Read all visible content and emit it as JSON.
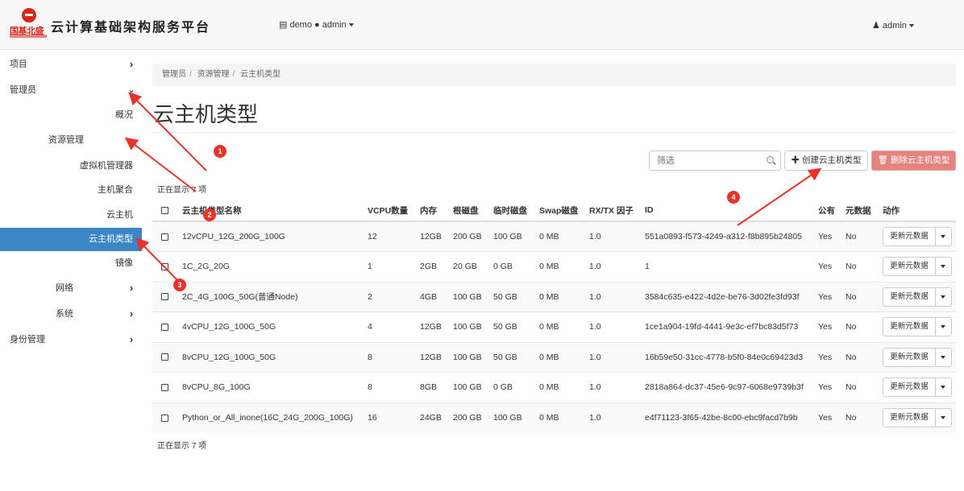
{
  "header": {
    "logo_text": "国基北盛",
    "title": "云计算基础架构服务平台",
    "project_switch": "▤ demo ● admin",
    "user_menu": "♟ admin"
  },
  "sidebar": {
    "items": [
      {
        "label": "项目"
      },
      {
        "label": "管理员"
      },
      {
        "label": "概况"
      },
      {
        "label": "资源管理"
      },
      {
        "label": "虚拟机管理器"
      },
      {
        "label": "主机聚合"
      },
      {
        "label": "云主机"
      },
      {
        "label": "云主机类型"
      },
      {
        "label": "镜像"
      },
      {
        "label": "网络"
      },
      {
        "label": "系统"
      },
      {
        "label": "身份管理"
      }
    ]
  },
  "breadcrumb": [
    "管理员",
    "资源管理",
    "云主机类型"
  ],
  "page_title": "云主机类型",
  "toolbar": {
    "filter_placeholder": "筛选",
    "create_label": "✚ 创建云主机类型",
    "delete_label": "🗑 删除云主机类型"
  },
  "count_text": "正在显示 7 项",
  "table": {
    "headers": [
      "云主机类型名称",
      "VCPU数量",
      "内存",
      "根磁盘",
      "临时磁盘",
      "Swap磁盘",
      "RX/TX 因子",
      "ID",
      "公有",
      "元数据",
      "动作"
    ],
    "rows": [
      {
        "name": "12vCPU_12G_200G_100G",
        "vcpu": "12",
        "ram": "12GB",
        "root": "200 GB",
        "eph": "100 GB",
        "swap": "0 MB",
        "rxtx": "1.0",
        "id": "551a0893-f573-4249-a312-f8b895b24805",
        "public": "Yes",
        "meta": "No",
        "action": "更新元数据"
      },
      {
        "name": "1C_2G_20G",
        "vcpu": "1",
        "ram": "2GB",
        "root": "20 GB",
        "eph": "0 GB",
        "swap": "0 MB",
        "rxtx": "1.0",
        "id": "1",
        "public": "Yes",
        "meta": "No",
        "action": "更新元数据"
      },
      {
        "name": "2C_4G_100G_50G(普通Node)",
        "vcpu": "2",
        "ram": "4GB",
        "root": "100 GB",
        "eph": "50 GB",
        "swap": "0 MB",
        "rxtx": "1.0",
        "id": "3584c635-e422-4d2e-be76-3d02fe3fd93f",
        "public": "Yes",
        "meta": "No",
        "action": "更新元数据"
      },
      {
        "name": "4vCPU_12G_100G_50G",
        "vcpu": "4",
        "ram": "12GB",
        "root": "100 GB",
        "eph": "50 GB",
        "swap": "0 MB",
        "rxtx": "1.0",
        "id": "1ce1a904-19fd-4441-9e3c-ef7bc83d5f73",
        "public": "Yes",
        "meta": "No",
        "action": "更新元数据"
      },
      {
        "name": "8vCPU_12G_100G_50G",
        "vcpu": "8",
        "ram": "12GB",
        "root": "100 GB",
        "eph": "50 GB",
        "swap": "0 MB",
        "rxtx": "1.0",
        "id": "16b59e50-31cc-4778-b5f0-84e0c69423d3",
        "public": "Yes",
        "meta": "No",
        "action": "更新元数据"
      },
      {
        "name": "8vCPU_8G_100G",
        "vcpu": "8",
        "ram": "8GB",
        "root": "100 GB",
        "eph": "0 GB",
        "swap": "0 MB",
        "rxtx": "1.0",
        "id": "2818a864-dc37-45e6-9c97-6068e9739b3f",
        "public": "Yes",
        "meta": "No",
        "action": "更新元数据"
      },
      {
        "name": "Python_or_All_inone(16C_24G_200G_100G)",
        "vcpu": "16",
        "ram": "24GB",
        "root": "200 GB",
        "eph": "100 GB",
        "swap": "0 MB",
        "rxtx": "1.0",
        "id": "e4f71123-3f65-42be-8c00-ebc9facd7b9b",
        "public": "Yes",
        "meta": "No",
        "action": "更新元数据"
      }
    ]
  },
  "annotations": {
    "badges": [
      "1",
      "2",
      "3",
      "4"
    ],
    "color": "#e8322a"
  }
}
